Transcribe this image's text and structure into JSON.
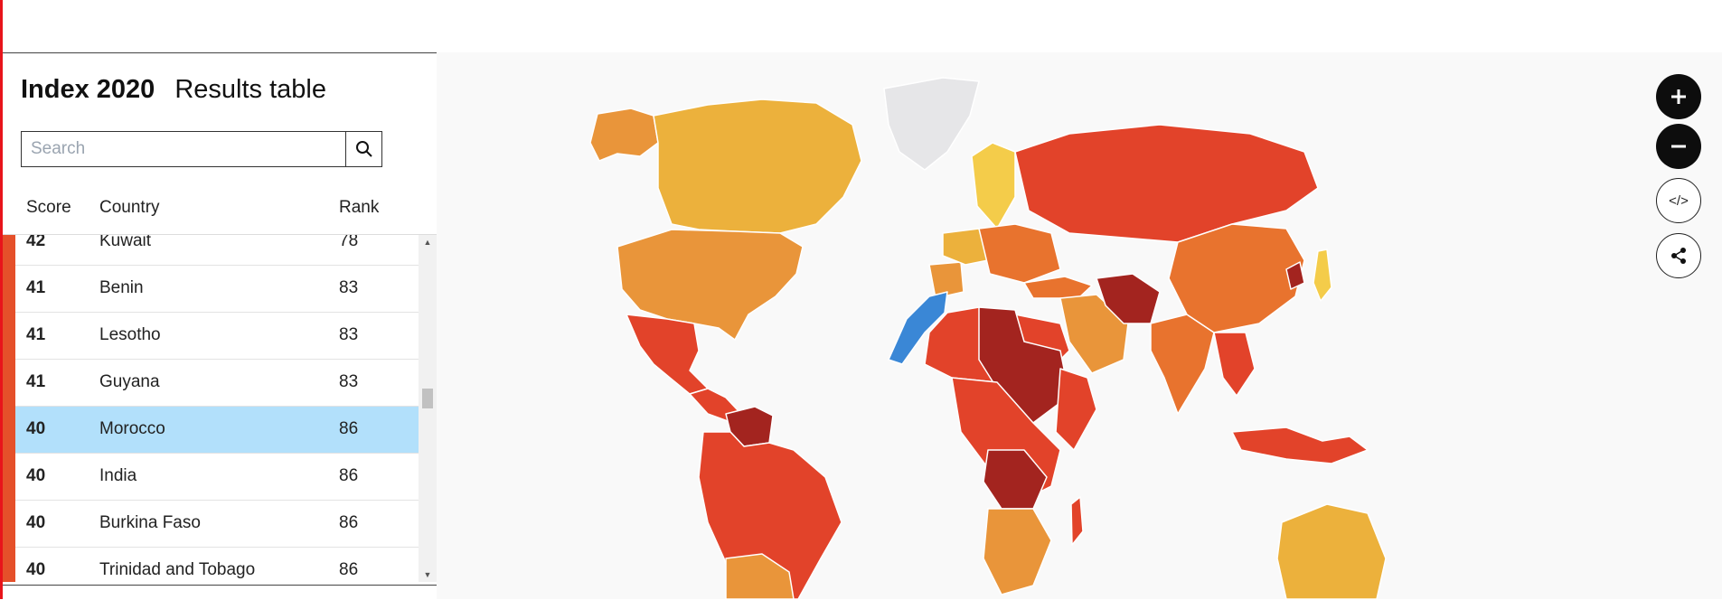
{
  "panel": {
    "index_label": "Index 2020",
    "results_label": "Results table",
    "search_placeholder": "Search",
    "headers": {
      "score": "Score",
      "country": "Country",
      "rank": "Rank"
    },
    "rows": [
      {
        "score": "42",
        "country": "Kuwait",
        "rank": "78"
      },
      {
        "score": "41",
        "country": "Benin",
        "rank": "83"
      },
      {
        "score": "41",
        "country": "Lesotho",
        "rank": "83"
      },
      {
        "score": "41",
        "country": "Guyana",
        "rank": "83"
      },
      {
        "score": "40",
        "country": "Morocco",
        "rank": "86"
      },
      {
        "score": "40",
        "country": "India",
        "rank": "86"
      },
      {
        "score": "40",
        "country": "Burkina Faso",
        "rank": "86"
      },
      {
        "score": "40",
        "country": "Trinidad and Tobago",
        "rank": "86"
      }
    ],
    "selected_country": "Morocco"
  },
  "map_controls": {
    "embed_label": "</>"
  },
  "colors": {
    "accent_red": "#e8141b",
    "selected_row": "#b2e0fb",
    "highlight_country": "#3a87d6",
    "score_low": "#a3241f",
    "score_mid_low": "#e2432a",
    "score_mid": "#e8732e",
    "score_mid_high": "#e9953a",
    "score_high": "#ecb13c",
    "score_top": "#f4cc4a",
    "no_data": "#e6e6e8"
  }
}
